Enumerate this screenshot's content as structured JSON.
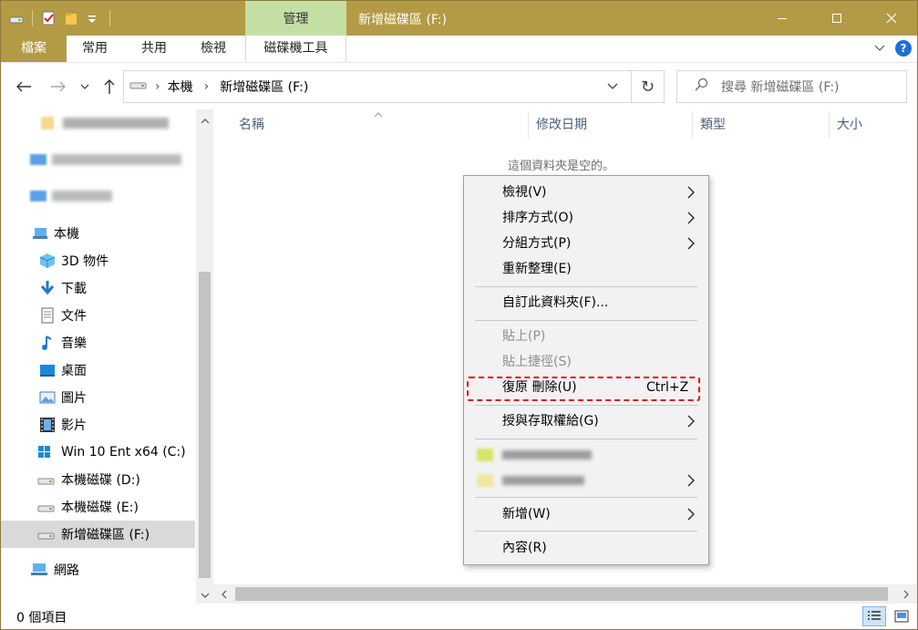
{
  "titlebar": {
    "context_tab": "管理",
    "title": "新增磁碟區 (F:)"
  },
  "ribbon": {
    "tabs": [
      "檔案",
      "常用",
      "共用",
      "檢視",
      "磁碟機工具"
    ]
  },
  "address": {
    "crumbs": [
      "本機",
      "新增磁碟區 (F:)"
    ]
  },
  "search": {
    "placeholder": "搜尋 新增磁碟區 (F:)"
  },
  "sidebar": {
    "items": [
      {
        "label": "本機",
        "icon": "pc-icon"
      },
      {
        "label": "3D 物件",
        "icon": "cube-3d-icon"
      },
      {
        "label": "下載",
        "icon": "download-arrow-icon"
      },
      {
        "label": "文件",
        "icon": "document-icon"
      },
      {
        "label": "音樂",
        "icon": "music-note-icon"
      },
      {
        "label": "桌面",
        "icon": "desktop-icon"
      },
      {
        "label": "圖片",
        "icon": "picture-icon"
      },
      {
        "label": "影片",
        "icon": "film-icon"
      },
      {
        "label": "Win 10 Ent x64 (C:)",
        "icon": "windows-drive-icon"
      },
      {
        "label": "本機磁碟 (D:)",
        "icon": "drive-icon"
      },
      {
        "label": "本機磁碟 (E:)",
        "icon": "drive-icon"
      },
      {
        "label": "新增磁碟區 (F:)",
        "icon": "drive-icon"
      },
      {
        "label": "網路",
        "icon": "network-icon"
      }
    ]
  },
  "columns": [
    "名稱",
    "修改日期",
    "類型",
    "大小"
  ],
  "empty_message": "這個資料夾是空的。",
  "status": {
    "item_count": "0 個項目"
  },
  "context_menu": {
    "view": "檢視(V)",
    "sort": "排序方式(O)",
    "group": "分組方式(P)",
    "refresh": "重新整理(E)",
    "customize": "自訂此資料夾(F)...",
    "paste": "貼上(P)",
    "paste_shortcut": "貼上捷徑(S)",
    "undo_delete": "復原 刪除(U)",
    "undo_shortcut": "Ctrl+Z",
    "give_access": "授與存取權給(G)",
    "new": "新增(W)",
    "properties": "內容(R)"
  }
}
